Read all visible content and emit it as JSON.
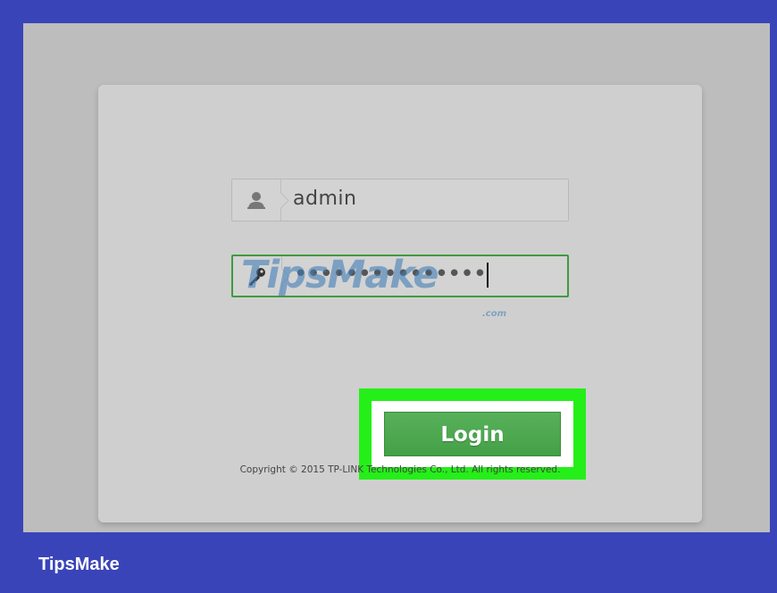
{
  "login": {
    "username_value": "admin",
    "password_value": "•••••••••••••••",
    "submit_label": "Login"
  },
  "footer": {
    "copyright": "Copyright © 2015 TP-LINK Technologies Co., Ltd. All rights reserved."
  },
  "watermark": {
    "text": "TipsMake",
    "suffix": ".com"
  },
  "brand": {
    "name": "TipsMake"
  },
  "icons": {
    "username": "user-icon",
    "password": "key-icon"
  },
  "colors": {
    "frame": "#3a44b9",
    "highlight": "#25ef18",
    "button": "#4aa34d"
  }
}
